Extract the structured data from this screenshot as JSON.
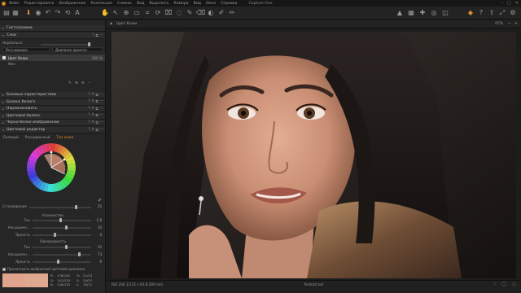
{
  "menubar": {
    "items": [
      "Файл",
      "Редактировать",
      "Изображение",
      "Коллекция",
      "Снимок",
      "Вид",
      "Выделить",
      "Камера",
      "Вид",
      "Окно",
      "Справка"
    ],
    "title": "Capture One",
    "window_controls": [
      "–",
      "□",
      "✕"
    ]
  },
  "viewer_header": {
    "variant_name": "Цвет Кожи",
    "zoom": "67%"
  },
  "left_panel": {
    "histogram_label": "Гистограмма",
    "layers_label": "Слои",
    "layer_mode": "Нормально",
    "layer_filter": "Регулировка",
    "layer_range": "Диапазон яркости",
    "layer_item_name": "Цвет Кожи",
    "layer_item_opacity": "100 %",
    "layer_subitem": "Фон",
    "sections": [
      "Базовые характеристики",
      "Баланс белого",
      "Нормализовать",
      "Цветовой баланс",
      "Черно-белое изображение",
      "Цветовой редактор"
    ],
    "editor_tabs": [
      "Базовый",
      "Расширенный",
      "Тон кожи"
    ],
    "smoothness_label": "Сглаживание",
    "smoothness_value": "25",
    "amount_header": "Количество",
    "amount_rows": [
      {
        "label": "Тон",
        "value": "-1,8"
      },
      {
        "label": "Насыщенн...",
        "value": "10"
      },
      {
        "label": "Яркость",
        "value": "0"
      }
    ],
    "uniformity_header": "Однородность",
    "uniformity_rows": [
      {
        "label": "Тон",
        "value": "35"
      },
      {
        "label": "Насыщенн...",
        "value": "73"
      },
      {
        "label": "Яркость",
        "value": "6"
      }
    ],
    "show_range_label": "Просмотреть выбранный цветовой диапазон",
    "color_readout": [
      {
        "ch": "R:",
        "val": "176/182",
        "ch2": "H:",
        "val2": "21/23"
      },
      {
        "ch": "G:",
        "val": "142/153",
        "ch2": "S:",
        "val2": "24/27"
      },
      {
        "ch": "B:",
        "val": "126/132",
        "ch2": "L:",
        "val2": "70/71"
      }
    ],
    "swatch_colors": [
      "#e0a48e",
      "#dfa98f"
    ]
  },
  "statusbar": {
    "left": "ISO 200   1/125 s   f/3.8   200 mm",
    "filename": "Portrait.nef"
  },
  "colors": {
    "accent": "#e08a2c",
    "panel_bg": "#262626"
  }
}
